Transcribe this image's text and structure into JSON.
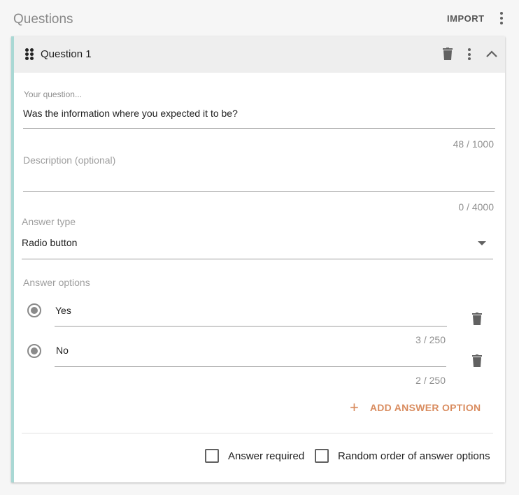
{
  "header": {
    "title": "Questions",
    "import_label": "IMPORT"
  },
  "question": {
    "title": "Question 1",
    "question_label": "Your question...",
    "question_value": "Was the information where you expected it to be?",
    "question_counter": "48 / 1000",
    "description_placeholder": "Description (optional)",
    "description_value": "",
    "description_counter": "0 / 4000",
    "answer_type_label": "Answer type",
    "answer_type_value": "Radio button",
    "answer_options_label": "Answer options",
    "options": [
      {
        "label": "Yes",
        "counter": "3 / 250"
      },
      {
        "label": "No",
        "counter": "2 / 250"
      }
    ],
    "add_option_icon": "+",
    "add_option_label": "ADD ANSWER OPTION",
    "answer_required_label": "Answer required",
    "answer_required_checked": false,
    "random_order_label": "Random order of answer options",
    "random_order_checked": false
  },
  "colors": {
    "accent_border": "#a9d8d4",
    "add_option": "#d98c5f",
    "header_bg": "#eeeeee"
  },
  "icons": {
    "header_menu": "more-vert-icon",
    "drag": "drag-handle-icon",
    "delete": "trash-icon",
    "card_menu": "more-vert-icon",
    "collapse": "chevron-up-icon",
    "radio": "radio-selected-icon",
    "dropdown": "caret-down-icon",
    "add": "plus-icon"
  }
}
